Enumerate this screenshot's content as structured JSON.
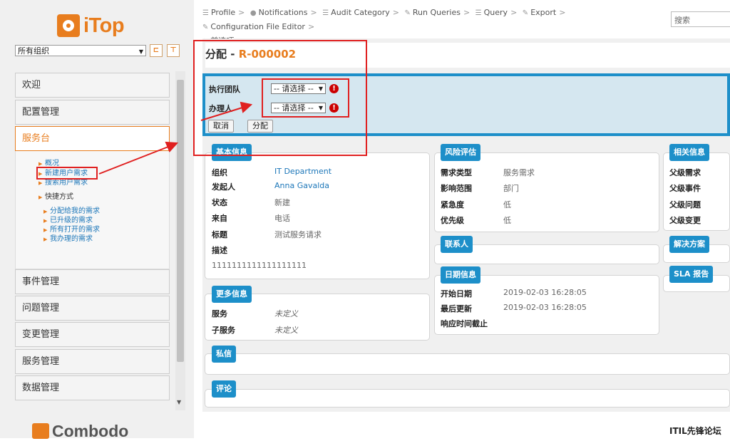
{
  "app": {
    "logo_text": "iTop",
    "footer_logo": "Combodo"
  },
  "sidebar": {
    "org_select": "所有组织",
    "accordion": [
      "欢迎",
      "配置管理",
      "服务台",
      "事件管理",
      "问题管理",
      "变更管理",
      "服务管理",
      "数据管理"
    ],
    "servicedesk_links": {
      "overview": "概况",
      "new_request": "新建用户需求",
      "search_request": "搜索用户需求",
      "shortcuts": "快捷方式",
      "assigned_to_me": "分配给我的需求",
      "escalated": "已升级的需求",
      "all_open": "所有打开的需求",
      "my_handled": "我办理的需求"
    }
  },
  "breadcrumbs": [
    "Profile",
    "Notifications",
    "Audit Category",
    "Run Queries",
    "Query",
    "Export",
    "Configuration File Editor",
    "首选项..."
  ],
  "search": {
    "placeholder": "搜索"
  },
  "page": {
    "title_action": "分配",
    "separator": " - ",
    "ref": "R-000002"
  },
  "form": {
    "team_label": "执行团队",
    "agent_label": "办理人",
    "select_placeholder": "-- 请选择 --",
    "cancel": "取消",
    "assign": "分配"
  },
  "sections": {
    "basic": {
      "title": "基本信息",
      "fields": [
        {
          "label": "组织",
          "value": "IT Department"
        },
        {
          "label": "发起人",
          "value": "Anna Gavalda"
        },
        {
          "label": "状态",
          "value": "新建"
        },
        {
          "label": "来自",
          "value": "电话"
        },
        {
          "label": "标题",
          "value": "测试服务请求"
        },
        {
          "label": "描述",
          "value": ""
        }
      ],
      "description": "1111111111111111111"
    },
    "more": {
      "title": "更多信息",
      "fields": [
        {
          "label": "服务",
          "value": "未定义"
        },
        {
          "label": "子服务",
          "value": "未定义"
        }
      ]
    },
    "private": {
      "title": "私信"
    },
    "comments": {
      "title": "评论"
    },
    "risk": {
      "title": "风险评估",
      "fields": [
        {
          "label": "需求类型",
          "value": "服务需求"
        },
        {
          "label": "影响范围",
          "value": "部门"
        },
        {
          "label": "紧急度",
          "value": "低"
        },
        {
          "label": "优先级",
          "value": "低"
        }
      ]
    },
    "contacts": {
      "title": "联系人"
    },
    "dates": {
      "title": "日期信息",
      "fields": [
        {
          "label": "开始日期",
          "value": "2019-02-03 16:28:05"
        },
        {
          "label": "最后更新",
          "value": "2019-02-03 16:28:05"
        },
        {
          "label": "响应时间截止",
          "value": ""
        }
      ]
    },
    "related": {
      "title": "相关信息",
      "items": [
        "父级需求",
        "父级事件",
        "父级问题",
        "父级变更"
      ]
    },
    "resolution": {
      "title": "解决方案"
    },
    "sla": {
      "title": "SLA 报告"
    }
  },
  "watermark": "ITIL先锋论坛",
  "colors": {
    "brand_orange": "#e87d1e",
    "accent_blue": "#1d8fc9",
    "annotation_red": "#e02020"
  }
}
